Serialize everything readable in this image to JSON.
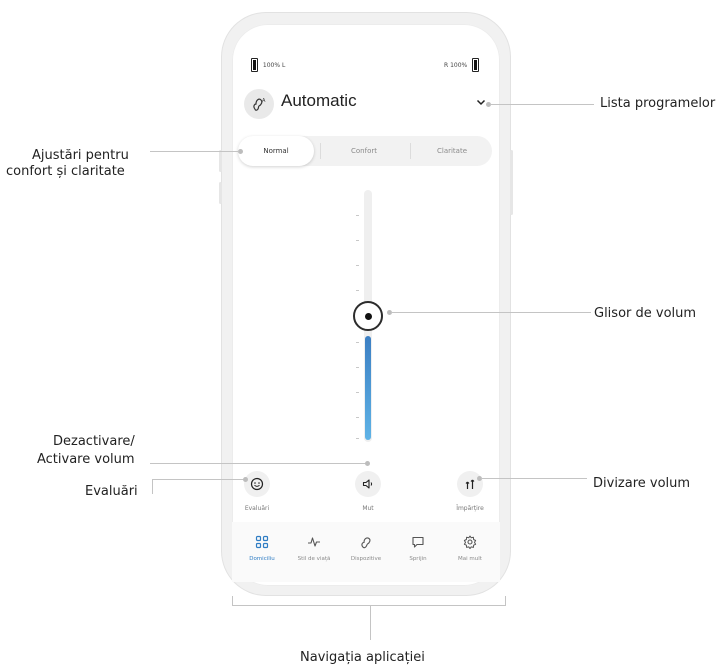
{
  "status": {
    "left_battery": "100% L",
    "right_battery": "R 100%"
  },
  "program": {
    "title": "Automatic",
    "icon": "ear-a-icon"
  },
  "adjust_tabs": [
    {
      "label": "Normal",
      "active": true
    },
    {
      "label": "Confort",
      "active": false
    },
    {
      "label": "Claritate",
      "active": false
    }
  ],
  "volume": {
    "level": 0.43
  },
  "actions": {
    "ratings": {
      "label": "Evaluări",
      "icon": "smiley-icon"
    },
    "mute": {
      "label": "Mut",
      "icon": "speaker-icon"
    },
    "split": {
      "label": "Împărțire",
      "icon": "split-volume-icon"
    }
  },
  "nav": [
    {
      "label": "Domiciliu",
      "icon": "home-grid-icon",
      "active": true
    },
    {
      "label": "Stil de viață",
      "icon": "activity-icon",
      "active": false
    },
    {
      "label": "Dispozitive",
      "icon": "hearing-aid-icon",
      "active": false
    },
    {
      "label": "Sprijin",
      "icon": "chat-icon",
      "active": false
    },
    {
      "label": "Mai mult",
      "icon": "gear-icon",
      "active": false
    }
  ],
  "annotations": {
    "program_list": "Lista programelor",
    "comfort_line1": "Ajustări pentru",
    "comfort_line2": "confort și claritate",
    "volume_slider": "Glisor de volum",
    "mute_line1": "Dezactivare/",
    "mute_line2": "Activare volum",
    "ratings": "Evaluări",
    "split_volume": "Divizare volum",
    "app_nav": "Navigația aplicației"
  },
  "colors": {
    "accent": "#2f7dc4",
    "slider_top": "#3c7fc3",
    "slider_bottom": "#5fb3e6"
  }
}
